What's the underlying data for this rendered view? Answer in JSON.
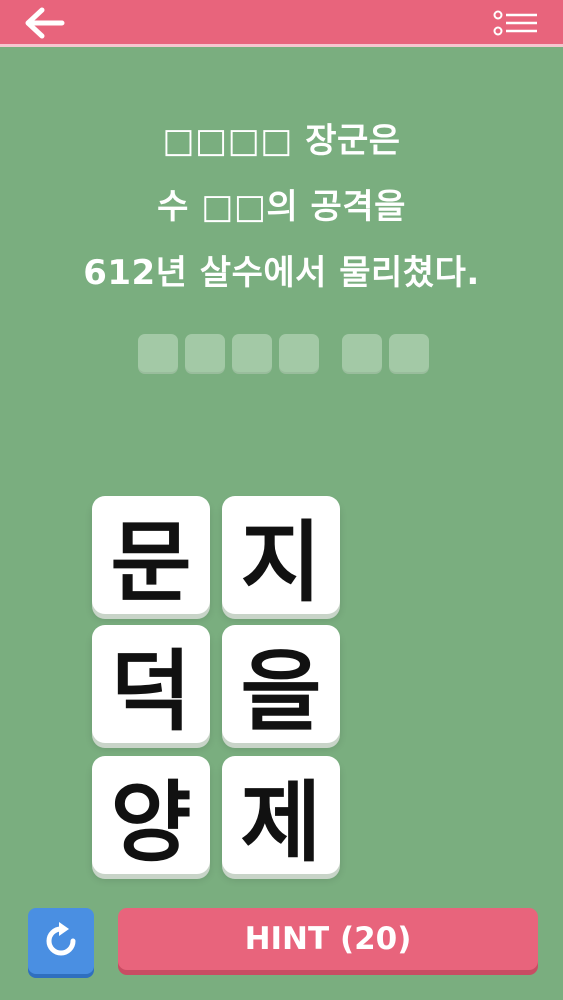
{
  "header": {
    "back_icon": "arrow-left-icon",
    "menu_icon": "menu-list-icon"
  },
  "question": {
    "lines": [
      "□□□□ 장군은",
      "수 □□의 공격을",
      "612년 살수에서 물리쳤다."
    ]
  },
  "answer_slots": {
    "groups": [
      4,
      2
    ],
    "filled": 0
  },
  "tiles": [
    "문",
    "지",
    "덕",
    "을",
    "양",
    "제"
  ],
  "footer": {
    "refresh_icon": "refresh-icon",
    "hint_label": "HINT (20)"
  },
  "colors": {
    "background": "#7aae7f",
    "accent": "#e8647c",
    "refresh": "#4a8fe2",
    "slot_empty": "#a3c9a6"
  }
}
